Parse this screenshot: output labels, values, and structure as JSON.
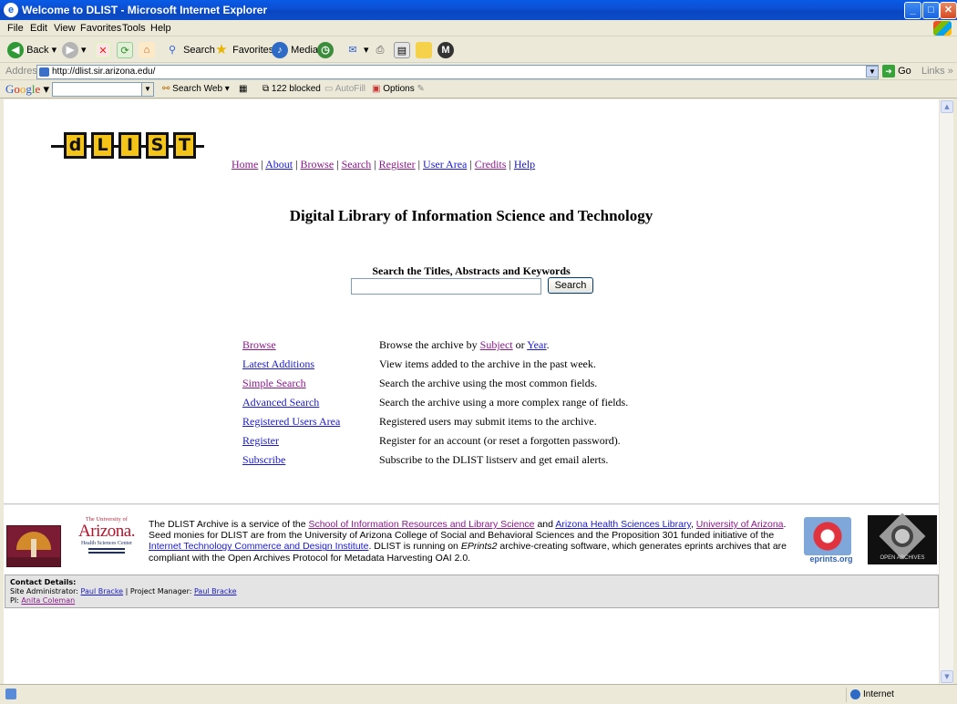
{
  "window": {
    "title": "Welcome to DLIST - Microsoft Internet Explorer",
    "min": "_",
    "max": "□",
    "close": "✕"
  },
  "menubar": {
    "items": [
      "File",
      "Edit",
      "View",
      "Favorites",
      "Tools",
      "Help"
    ]
  },
  "toolbar": {
    "back": "Back",
    "search": "Search",
    "favorites": "Favorites",
    "media": "Media"
  },
  "address": {
    "label": "Address",
    "url": "http://dlist.sir.arizona.edu/",
    "go": "Go",
    "links": "Links »"
  },
  "googlebar": {
    "search_web": "Search Web",
    "blocked": "122 blocked",
    "autofill": "AutoFill",
    "options": "Options"
  },
  "page": {
    "logo_letters": [
      "d",
      "L",
      "I",
      "S",
      "T"
    ],
    "nav": [
      "Home",
      "About",
      "Browse",
      "Search",
      "Register",
      "User Area",
      "Credits",
      "Help"
    ],
    "title": "Digital Library of Information Science and Technology",
    "search_label": "Search the Titles, Abstracts and Keywords",
    "search_button": "Search",
    "menu": [
      {
        "link": "Browse",
        "desc_pre": "Browse the archive by ",
        "desc_link1": "Subject",
        "desc_mid": " or ",
        "desc_link2": "Year",
        "desc_post": "."
      },
      {
        "link": "Latest Additions",
        "desc": "View items added to the archive in the past week."
      },
      {
        "link": "Simple Search",
        "desc": "Search the archive using the most common fields."
      },
      {
        "link": "Advanced Search",
        "desc": "Search the archive using a more complex range of fields."
      },
      {
        "link": "Registered Users Area",
        "desc": "Registered users may submit items to the archive."
      },
      {
        "link": "Register",
        "desc": "Register for an account (or reset a forgotten password)."
      },
      {
        "link": "Subscribe",
        "desc": "Subscribe to the DLIST listserv and get email alerts."
      }
    ],
    "arizona": {
      "university": "The University of",
      "name": "Arizona.",
      "hsc": "Health Sciences Center"
    },
    "footer": {
      "t1": "The DLIST Archive is a service of the ",
      "l1": "School of Information Resources and Library Science",
      "t2": " and ",
      "l2": "Arizona Health Sciences Library",
      "t3": ", ",
      "l3": "University of Arizona",
      "t4": ". Seed monies for DLIST are from the University of Arizona College of Social and Behavioral Sciences and the Proposition 301 funded initiative of the ",
      "l4": "Internet Technology Commerce and Design Institute",
      "t5": ". DLIST is running on ",
      "em": "EPrints2",
      "t6": " archive-creating software, which generates eprints archives that are compliant with the Open Archives Protocol for Metadata Harvesting OAI 2.0."
    },
    "eprints_label": "eprints.org",
    "oa_label": "OPEN ARCHIVES",
    "contact": {
      "heading": "Contact Details:",
      "site_admin_label": "Site Administrator: ",
      "site_admin": "Paul Bracke",
      "pm_label": " | Project Manager: ",
      "pm": "Paul Bracke",
      "pi_label": "PI: ",
      "pi": "Anita Coleman"
    }
  },
  "status": {
    "zone": "Internet"
  }
}
